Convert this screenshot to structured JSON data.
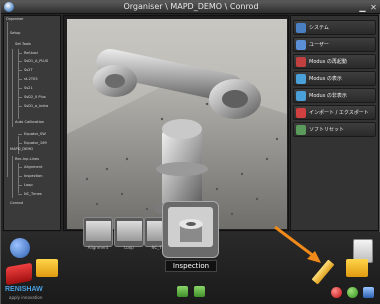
{
  "window": {
    "title": "Organiser \\ MAPD_DEMO \\ Conrod"
  },
  "tree": {
    "items": [
      "Organiser",
      "Setup",
      "Set Tools",
      "Ref-tool",
      "SsD1_A_PLUS",
      "Ss2T",
      "st-2T05",
      "Ss21",
      "SsD2_0 Plus",
      "SsD1_a_indra",
      "Auto Calibration",
      "Equator_SW",
      "Equator_169",
      "MAPD_DEMO",
      "Rec-Inp.Lines",
      "Alignment",
      "Inspection",
      "Loop",
      "NC_Times",
      "Conrod"
    ]
  },
  "menu": {
    "items": [
      {
        "label": "システム",
        "icon": "system-icon",
        "color": "#4a7fc1"
      },
      {
        "label": "ユーザー",
        "icon": "user-icon",
        "color": "#5b8fd6"
      },
      {
        "label": "Modus の再起動",
        "icon": "restart-icon",
        "color": "#c04040"
      },
      {
        "label": "Modus の表示",
        "icon": "show-icon",
        "color": "#4aa0d8"
      },
      {
        "label": "Modus の非表示",
        "icon": "hide-icon",
        "color": "#4aa0d8"
      },
      {
        "label": "インポート / エクスポート",
        "icon": "import-export-icon",
        "color": "#d04040"
      },
      {
        "label": "ソフトリセット",
        "icon": "soft-reset-icon",
        "color": "#5a9a5a"
      }
    ]
  },
  "thumbnails": [
    {
      "label": "Alignment"
    },
    {
      "label": "Loop"
    },
    {
      "label": "NC_Ti..."
    }
  ],
  "tooltip": "Inspection",
  "brand": {
    "logo_text": "RENISHAW",
    "tagline": "apply innovation"
  }
}
